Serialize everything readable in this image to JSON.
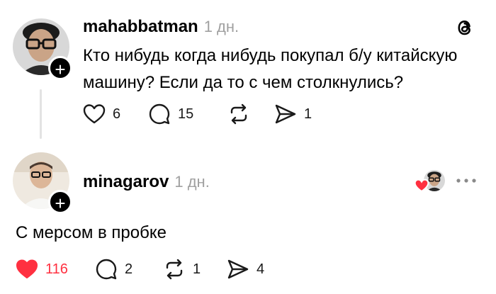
{
  "post": {
    "username": "mahabbatman",
    "time": "1 дн.",
    "text_line1": "Кто нибудь когда нибудь покупал б/у китайскую",
    "text_line2": "машину? Если да то с чем столкнулись?",
    "likes": "6",
    "replies": "15",
    "reposts": "",
    "shares": "1"
  },
  "reply": {
    "username": "minagarov",
    "time": "1 дн.",
    "text": "С мерсом в пробке",
    "likes": "116",
    "replies": "2",
    "reposts": "1",
    "shares": "4",
    "liked": true
  },
  "icons": {
    "app_logo": "threads-logo-icon",
    "like": "heart-icon",
    "reply": "comment-icon",
    "repost": "repost-icon",
    "share": "send-icon",
    "more": "more-icon",
    "follow": "plus-icon"
  },
  "colors": {
    "like_active": "#ff3040",
    "muted": "#a0a0a0",
    "thread_line": "#e3e3e3"
  }
}
